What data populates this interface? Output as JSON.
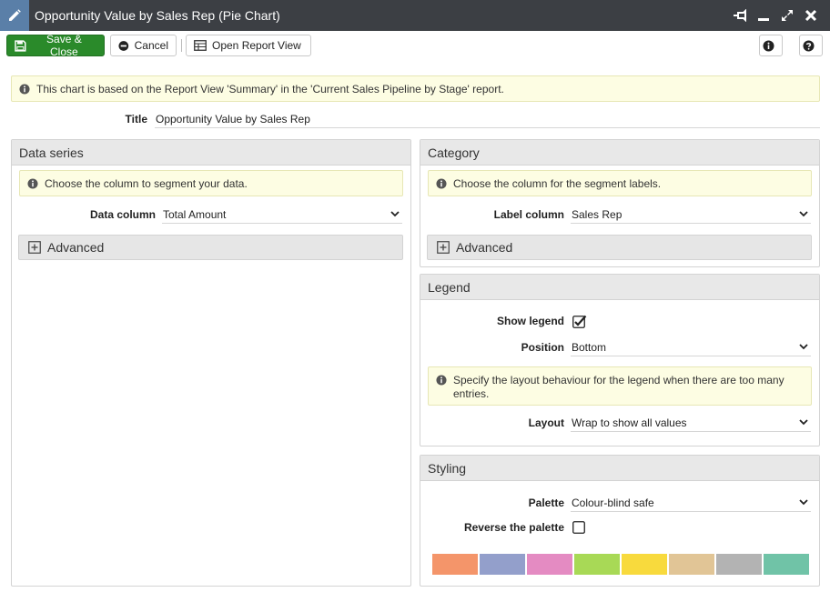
{
  "window": {
    "title": "Opportunity Value by Sales Rep (Pie Chart)",
    "icons": [
      "pencil-icon",
      "pin-icon",
      "minimize-icon",
      "maximize-icon",
      "close-icon"
    ]
  },
  "toolbar": {
    "save_label": "Save & Close",
    "cancel_label": "Cancel",
    "open_view_label": "Open Report View"
  },
  "info_banner": "This chart is based on the Report View 'Summary' in the 'Current Sales Pipeline by Stage' report.",
  "title_field": {
    "label": "Title",
    "value": "Opportunity Value by Sales Rep"
  },
  "data_series": {
    "header": "Data series",
    "hint": "Choose the column to segment your data.",
    "data_column_label": "Data column",
    "data_column_value": "Total Amount",
    "advanced_label": "Advanced"
  },
  "category": {
    "header": "Category",
    "hint": "Choose the column for the segment labels.",
    "label_column_label": "Label column",
    "label_column_value": "Sales Rep",
    "advanced_label": "Advanced"
  },
  "legend": {
    "header": "Legend",
    "show_legend_label": "Show legend",
    "show_legend_checked": true,
    "position_label": "Position",
    "position_value": "Bottom",
    "hint": "Specify the layout behaviour for the legend when there are too many entries.",
    "layout_label": "Layout",
    "layout_value": "Wrap to show all values"
  },
  "styling": {
    "header": "Styling",
    "palette_label": "Palette",
    "palette_value": "Colour-blind safe",
    "reverse_label": "Reverse the palette",
    "reverse_checked": false,
    "palette_colors": [
      "#f4956a",
      "#939fcb",
      "#e48bc2",
      "#a8d956",
      "#f8da3d",
      "#e1c596",
      "#b3b3b3",
      "#70c3a7"
    ]
  },
  "colors": {
    "titlebar_bg": "#3c3f44",
    "save_button_bg": "#2a8a2a",
    "info_bg": "#fdfde3"
  }
}
